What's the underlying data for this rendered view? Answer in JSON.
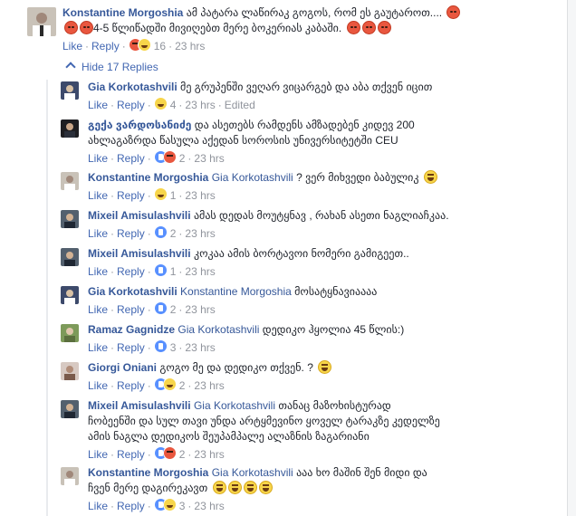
{
  "colors": {
    "link_blue": "#365899",
    "action_blue": "#4267b2",
    "meta_gray": "#90949c",
    "text": "#1d2129"
  },
  "top_comment": {
    "author": "Konstantine Morgoshia",
    "line1": "ამ პატარა ლაწირაკ გოგოს, რომ ეს გაუტაროთ....",
    "line2": "4-5 წლიწადში მივიღებთ მერე ბოკერიას კაბაში.",
    "like": "Like",
    "reply": "Reply",
    "reactions": [
      "angry",
      "laugh"
    ],
    "reaction_count": "16",
    "time": "23 hrs"
  },
  "toggle": {
    "label": "Hide 17 Replies"
  },
  "replies": [
    {
      "author": "Gia Korkotashvili",
      "mention": "",
      "text": "მე გრუპენში ვეღარ ვიცარგებ და აბა თქვენ იცით",
      "text2": "",
      "emojis_after": 0,
      "like": "Like",
      "reply": "Reply",
      "reactions": [
        "laugh"
      ],
      "count": "4",
      "time": "23 hrs",
      "edited": "Edited"
    },
    {
      "author": "გექა ვარდოსანიძე",
      "mention": "",
      "text": "და ასეთებს რამდენს ამზადებენ კიდევ 200",
      "text2": "ახლაგაზრდა წასულა აქედან სოროსის უნივერსიტეტში CEU",
      "emojis_after": 0,
      "like": "Like",
      "reply": "Reply",
      "reactions": [
        "like",
        "angry"
      ],
      "count": "2",
      "time": "23 hrs",
      "edited": ""
    },
    {
      "author": "Konstantine Morgoshia",
      "mention": "Gia Korkotashvili",
      "text": "? ვერ მიხვედი ბაბულიკ",
      "text2": "",
      "emojis_after": 1,
      "like": "Like",
      "reply": "Reply",
      "reactions": [
        "laugh"
      ],
      "count": "1",
      "time": "23 hrs",
      "edited": ""
    },
    {
      "author": "Mixeil Amisulashvili",
      "mention": "",
      "text": "ამას დედას მოუტყნავ , რახან ასეთი ნაგლიაჩკაა.",
      "text2": "",
      "emojis_after": 0,
      "like": "Like",
      "reply": "Reply",
      "reactions": [
        "like"
      ],
      "count": "2",
      "time": "23 hrs",
      "edited": ""
    },
    {
      "author": "Mixeil Amisulashvili",
      "mention": "",
      "text": "კოკაა ამის ბორტავოი ნომერი გამიგეეთ..",
      "text2": "",
      "emojis_after": 0,
      "like": "Like",
      "reply": "Reply",
      "reactions": [
        "like"
      ],
      "count": "1",
      "time": "23 hrs",
      "edited": ""
    },
    {
      "author": "Gia Korkotashvili",
      "mention": "Konstantine Morgoshia",
      "text": "მოსატყნავიაააა",
      "text2": "",
      "emojis_after": 0,
      "like": "Like",
      "reply": "Reply",
      "reactions": [
        "like"
      ],
      "count": "2",
      "time": "23 hrs",
      "edited": ""
    },
    {
      "author": "Ramaz Gagnidze",
      "mention": "Gia Korkotashvili",
      "text": "დედიკო ჰყოლია 45 წლის:)",
      "text2": "",
      "emojis_after": 0,
      "like": "Like",
      "reply": "Reply",
      "reactions": [
        "like"
      ],
      "count": "3",
      "time": "23 hrs",
      "edited": ""
    },
    {
      "author": "Giorgi Oniani",
      "mention": "",
      "text": "გოგო მე და დედიკო თქვენ. ?",
      "text2": "",
      "emojis_after": 1,
      "like": "Like",
      "reply": "Reply",
      "reactions": [
        "like",
        "laugh"
      ],
      "count": "2",
      "time": "23 hrs",
      "edited": ""
    },
    {
      "author": "Mixeil Amisulashvili",
      "mention": "Gia Korkotashvili",
      "text": "თანაც მაზოხისტურად",
      "text2": "ჩობეენში და სულ თავი უნდა არტყმევინო ყოველ ტარაკზე კედელზე",
      "text3": "ამის ნაგლა დედიკოს შეუპამპალე ალაზნის ზაგარიანი",
      "emojis_after": 0,
      "like": "Like",
      "reply": "Reply",
      "reactions": [
        "like",
        "angry"
      ],
      "count": "2",
      "time": "23 hrs",
      "edited": ""
    },
    {
      "author": "Konstantine Morgoshia",
      "mention": "Gia Korkotashvili",
      "text": "ააა ხო მაშინ შენ მიდი და",
      "text2": "ჩვენ მერე დაგირეკავთ",
      "emojis_after": 4,
      "like": "Like",
      "reply": "Reply",
      "reactions": [
        "like",
        "laugh"
      ],
      "count": "3",
      "time": "23 hrs",
      "edited": ""
    }
  ]
}
